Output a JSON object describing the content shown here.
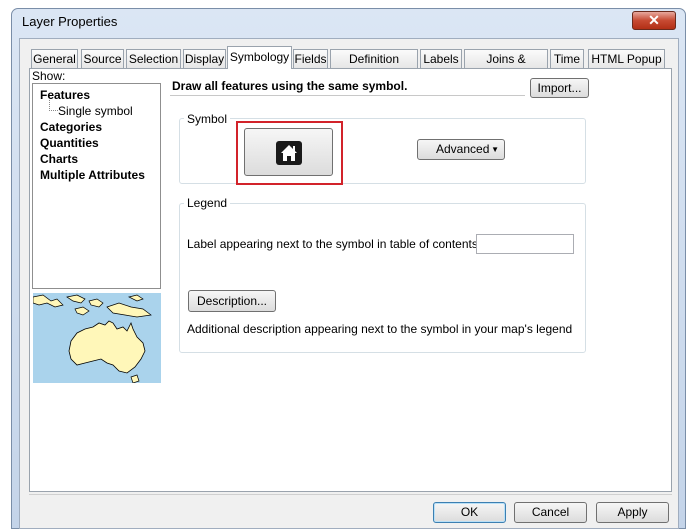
{
  "window": {
    "title": "Layer Properties",
    "close_glyph": "✕"
  },
  "tabs": [
    {
      "label": "General"
    },
    {
      "label": "Source"
    },
    {
      "label": "Selection"
    },
    {
      "label": "Display"
    },
    {
      "label": "Symbology",
      "active": true
    },
    {
      "label": "Fields"
    },
    {
      "label": "Definition Query"
    },
    {
      "label": "Labels"
    },
    {
      "label": "Joins & Relates"
    },
    {
      "label": "Time"
    },
    {
      "label": "HTML Popup"
    }
  ],
  "show": {
    "label": "Show:",
    "items": [
      {
        "label": "Features"
      },
      {
        "label": "Single symbol"
      },
      {
        "label": "Categories"
      },
      {
        "label": "Quantities"
      },
      {
        "label": "Charts"
      },
      {
        "label": "Multiple Attributes"
      }
    ],
    "selected": "Single symbol"
  },
  "symbology": {
    "description": "Draw all features using the same symbol.",
    "import_label": "Import...",
    "symbol_group_label": "Symbol",
    "symbol_icon": "house-symbol-icon",
    "advanced_label": "Advanced",
    "legend_group_label": "Legend",
    "legend_label_text": "Label appearing next to the symbol in table of contents:",
    "legend_input_value": "",
    "description_button_label": "Description...",
    "description_hint": "Additional description appearing next to the symbol in your map's legend"
  },
  "footer": {
    "ok_label": "OK",
    "cancel_label": "Cancel",
    "apply_label": "Apply"
  },
  "colors": {
    "highlight": "#d2232a",
    "map_water": "#aad3ec",
    "map_land": "#fff7b9"
  }
}
